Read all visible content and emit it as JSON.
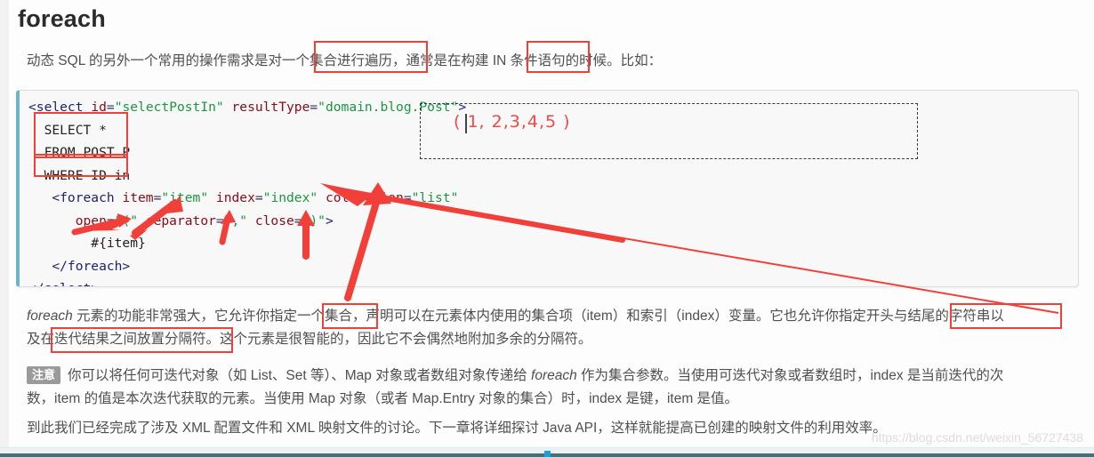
{
  "page": {
    "title": "foreach",
    "lead": "动态 SQL 的另外一个常用的操作需求是对一个集合进行遍历，通常是在构建 IN 条件语句的时候。比如："
  },
  "code": {
    "lines": [
      "<select id=\"selectPostIn\" resultType=\"domain.blog.Post\">",
      "  SELECT *",
      "  FROM POST P",
      "  WHERE ID in",
      "   <foreach item=\"item\" index=\"index\" collection=\"list\"",
      "      open=\"(\" separator=\",\" close=\")\">",
      "        #{item}",
      "   </foreach>",
      "</select>"
    ],
    "sample_output": "( 1, 2,3,4,5 )"
  },
  "annotations": {
    "highlight_lead_1": "一个集合进行遍历，",
    "highlight_lead_2": "IN",
    "highlight_code_1": "SELECT *  FROM POST P",
    "highlight_code_2": "WHERE ID in",
    "highlight_para_1": "一个集合",
    "highlight_para_2": "及在迭代结果之间放置分隔符。",
    "highlight_para_3": "开头与结尾的字符串以",
    "accent_red": "#f1403a",
    "accent_teal": "#6fb3c9",
    "code_bg": "#f8f8f8"
  },
  "paragraphs": {
    "p1_italic": "foreach",
    "p1_rest": " 元素的功能非常强大，它允许你指定一个集合，声明可以在元素体内使用的集合项（item）和索引（index）变量。它也允许你指定开头与结尾的字符串以",
    "p1_line2": "及在迭代结果之间放置分隔符。这个元素是很智能的，因此它不会偶然地附加多余的分隔符。",
    "note_badge": "注意",
    "note_line1_a": "你可以将任何可迭代对象（如 List、Set 等）、Map 对象或者数组对象传递给 ",
    "note_line1_italic": "foreach",
    "note_line1_b": " 作为集合参数。当使用可迭代对象或者数组时，index 是当前迭代的次",
    "note_line2": "数，item 的值是本次迭代获取的元素。当使用 Map 对象（或者 Map.Entry 对象的集合）时，index 是键，item 是值。",
    "p3": "到此我们已经完成了涉及 XML 配置文件和 XML 映射文件的讨论。下一章将详细探讨 Java API，这样就能提高已创建的映射文件的利用效率。"
  },
  "footer": {
    "watermark": "https://blog.csdn.net/weixin_56727438"
  }
}
